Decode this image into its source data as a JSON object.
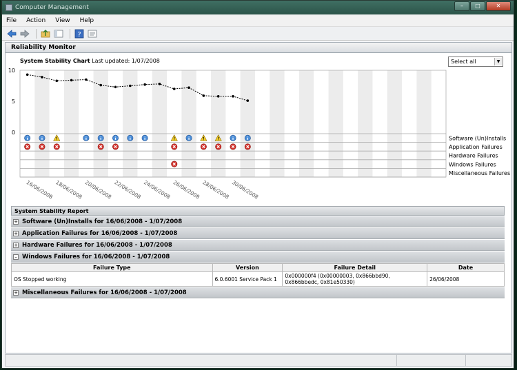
{
  "window": {
    "title": "Computer Management"
  },
  "menu": [
    "File",
    "Action",
    "View",
    "Help"
  ],
  "toolbar": [
    "back-icon",
    "forward-icon",
    "up-folder-icon",
    "show-hide-tree-icon",
    "help-icon",
    "properties-icon"
  ],
  "panel": {
    "title": "Reliability Monitor"
  },
  "chart_header": {
    "title": "System Stability Chart",
    "updated": "Last updated: 1/07/2008",
    "select_value": "Select all"
  },
  "chart_data": {
    "type": "line",
    "title": "System Stability Chart",
    "y_ticks": [
      "10",
      "5",
      "0"
    ],
    "ylim": [
      0,
      10
    ],
    "columns": 29,
    "x_ticks": [
      "16/06/2008",
      "18/06/2008",
      "20/06/2008",
      "22/06/2008",
      "24/06/2008",
      "26/06/2008",
      "28/06/2008",
      "30/06/2008"
    ],
    "x_tick_columns": [
      0,
      2,
      4,
      6,
      8,
      10,
      12,
      14
    ],
    "series": [
      {
        "values": [
          9.3,
          8.9,
          8.3,
          8.4,
          8.5,
          7.6,
          7.3,
          7.5,
          7.7,
          7.8,
          7.0,
          7.2,
          5.9,
          5.8,
          5.8,
          5.1
        ]
      }
    ],
    "row_labels": [
      "Software (Un)Installs",
      "Application Failures",
      "Hardware Failures",
      "Windows Failures",
      "Miscellaneous Failures"
    ],
    "events": [
      {
        "row": 0,
        "col": 0,
        "kind": "info"
      },
      {
        "row": 0,
        "col": 1,
        "kind": "info"
      },
      {
        "row": 0,
        "col": 2,
        "kind": "warning"
      },
      {
        "row": 0,
        "col": 4,
        "kind": "info"
      },
      {
        "row": 0,
        "col": 5,
        "kind": "info"
      },
      {
        "row": 0,
        "col": 6,
        "kind": "info"
      },
      {
        "row": 0,
        "col": 7,
        "kind": "info"
      },
      {
        "row": 0,
        "col": 8,
        "kind": "info"
      },
      {
        "row": 0,
        "col": 10,
        "kind": "warning"
      },
      {
        "row": 0,
        "col": 11,
        "kind": "info"
      },
      {
        "row": 0,
        "col": 12,
        "kind": "warning"
      },
      {
        "row": 0,
        "col": 13,
        "kind": "warning"
      },
      {
        "row": 0,
        "col": 14,
        "kind": "info"
      },
      {
        "row": 0,
        "col": 15,
        "kind": "info"
      },
      {
        "row": 1,
        "col": 0,
        "kind": "error"
      },
      {
        "row": 1,
        "col": 1,
        "kind": "error"
      },
      {
        "row": 1,
        "col": 2,
        "kind": "error"
      },
      {
        "row": 1,
        "col": 5,
        "kind": "error"
      },
      {
        "row": 1,
        "col": 6,
        "kind": "error"
      },
      {
        "row": 1,
        "col": 10,
        "kind": "error"
      },
      {
        "row": 1,
        "col": 12,
        "kind": "error"
      },
      {
        "row": 1,
        "col": 13,
        "kind": "error"
      },
      {
        "row": 1,
        "col": 14,
        "kind": "error"
      },
      {
        "row": 1,
        "col": 15,
        "kind": "error"
      },
      {
        "row": 3,
        "col": 10,
        "kind": "error"
      }
    ]
  },
  "report": {
    "title": "System Stability Report",
    "sections": {
      "software": {
        "label": "Software (Un)Installs for 16/06/2008 - 1/07/2008",
        "expanded": false
      },
      "application": {
        "label": "Application Failures for 16/06/2008 - 1/07/2008",
        "expanded": false
      },
      "hardware": {
        "label": "Hardware Failures for 16/06/2008 - 1/07/2008",
        "expanded": false
      },
      "windows": {
        "label": "Windows Failures for 16/06/2008 - 1/07/2008",
        "expanded": true
      },
      "misc": {
        "label": "Miscellaneous Failures for 16/06/2008 - 1/07/2008",
        "expanded": false
      }
    },
    "table": {
      "headers": [
        "Failure Type",
        "Version",
        "Failure Detail",
        "Date"
      ],
      "rows": [
        [
          "OS Stopped working",
          "6.0.6001 Service Pack 1",
          "0x000000f4 (0x00000003, 0x866bbd90, 0x866bbedc, 0x81e50330)",
          "26/06/2008"
        ]
      ]
    }
  }
}
